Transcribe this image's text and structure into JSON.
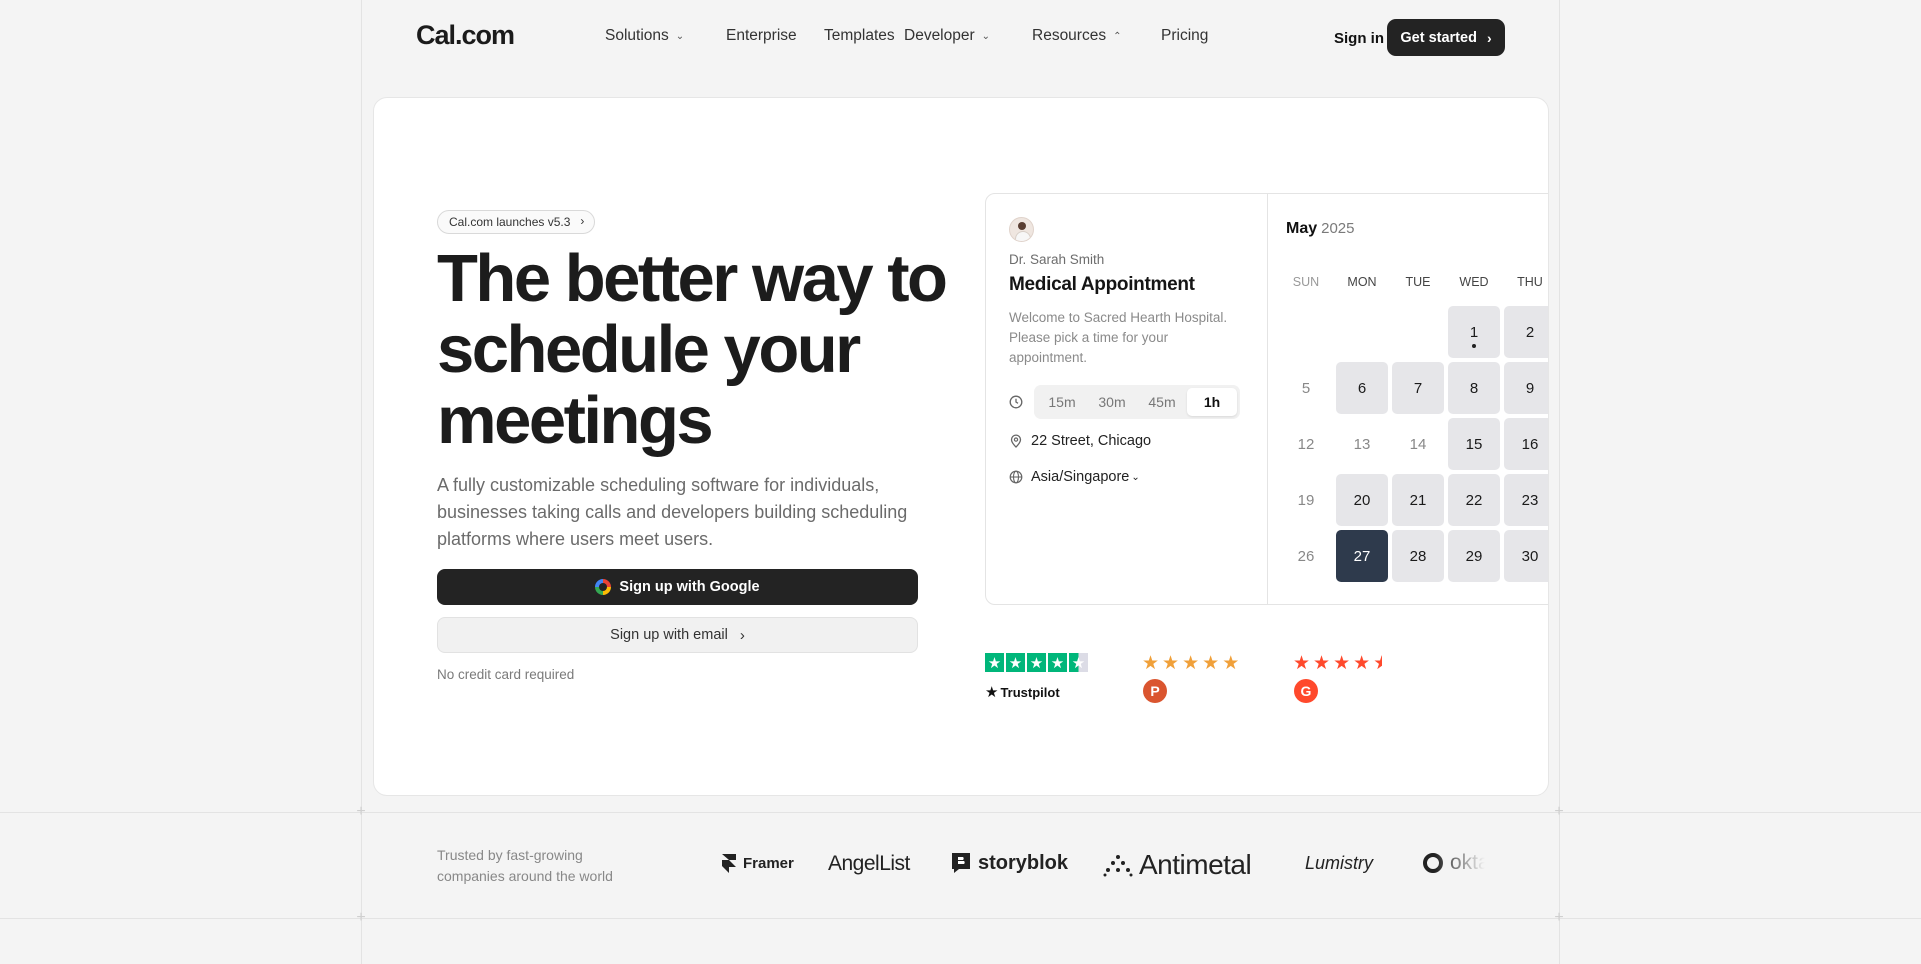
{
  "nav": {
    "logo": "Cal.com",
    "links": [
      {
        "label": "Solutions",
        "chevron": "down"
      },
      {
        "label": "Enterprise"
      },
      {
        "label": "Templates"
      },
      {
        "label": "Developer",
        "chevron": "down"
      },
      {
        "label": "Resources",
        "chevron": "up"
      },
      {
        "label": "Pricing"
      }
    ],
    "sign_in": "Sign in",
    "get_started": "Get started"
  },
  "hero": {
    "pill": "Cal.com launches v5.3",
    "headline": "The better way to schedule your meetings",
    "subtext": "A fully customizable scheduling software for individuals, businesses taking calls and developers building scheduling platforms where users meet users.",
    "google_button": "Sign up with Google",
    "email_button": "Sign up with email",
    "no_credit_card": "No credit card required"
  },
  "booker": {
    "host": "Dr. Sarah Smith",
    "title": "Medical Appointment",
    "description": "Welcome to Sacred Hearth Hospital. Please pick a time for your appointment.",
    "durations": [
      "15m",
      "30m",
      "45m",
      "1h"
    ],
    "active_duration": "1h",
    "location": "22 Street, Chicago",
    "timezone": "Asia/Singapore",
    "month": "May",
    "year": "2025",
    "weekdays": [
      "SUN",
      "MON",
      "TUE",
      "WED",
      "THU"
    ],
    "weeks": [
      [
        {
          "d": ""
        },
        {
          "d": ""
        },
        {
          "d": ""
        },
        {
          "d": "1",
          "avail": true,
          "dot": true
        },
        {
          "d": "2",
          "avail": true
        }
      ],
      [
        {
          "d": "5"
        },
        {
          "d": "6",
          "avail": true
        },
        {
          "d": "7",
          "avail": true
        },
        {
          "d": "8",
          "avail": true
        },
        {
          "d": "9",
          "avail": true
        }
      ],
      [
        {
          "d": "12"
        },
        {
          "d": "13"
        },
        {
          "d": "14"
        },
        {
          "d": "15",
          "avail": true
        },
        {
          "d": "16",
          "avail": true
        }
      ],
      [
        {
          "d": "19"
        },
        {
          "d": "20",
          "avail": true
        },
        {
          "d": "21",
          "avail": true
        },
        {
          "d": "22",
          "avail": true
        },
        {
          "d": "23",
          "avail": true
        }
      ],
      [
        {
          "d": "26"
        },
        {
          "d": "27",
          "selected": true
        },
        {
          "d": "28",
          "avail": true
        },
        {
          "d": "29",
          "avail": true
        },
        {
          "d": "30",
          "avail": true
        }
      ]
    ]
  },
  "reviews": {
    "trustpilot_label": "Trustpilot",
    "trustpilot_color": "#00b67a",
    "producthunt_color": "#da552f",
    "producthunt_star_color": "#f0a03a",
    "g2_color": "#ff492c",
    "producthunt_letter": "P",
    "g2_letter": "G"
  },
  "trusted": {
    "text": "Trusted by fast-growing companies around the world",
    "logos": [
      "Framer",
      "AngelList",
      "storyblok",
      "Antimetal",
      "Lumistry",
      "okta"
    ]
  }
}
